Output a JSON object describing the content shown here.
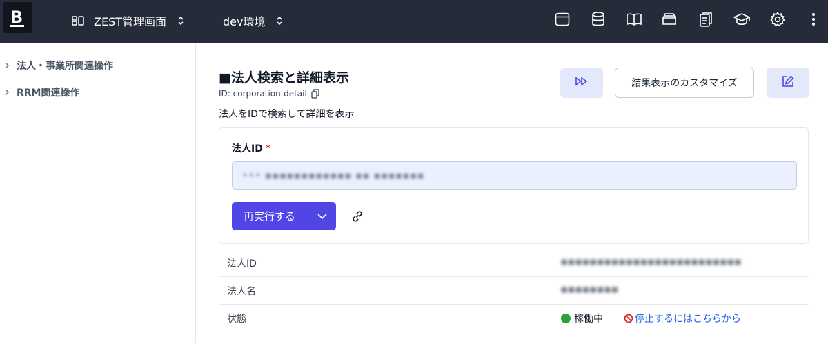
{
  "header": {
    "logo_letter": "B",
    "project_name": "ZEST管理画面",
    "environment": "dev環境",
    "icons": [
      "window-icon",
      "database-icon",
      "book-icon",
      "archive-icon",
      "clipboard-icon",
      "graduation-cap-icon",
      "gear-icon",
      "more-vertical-icon"
    ]
  },
  "sidebar": {
    "items": [
      {
        "label": "法人・事業所関連操作"
      },
      {
        "label": "RRM関連操作"
      }
    ]
  },
  "page": {
    "title": "■法人検索と詳細表示",
    "id_label": "ID: corporation-detail",
    "description": "法人をIDで検索して詳細を表示",
    "customize_label": "結果表示のカスタマイズ"
  },
  "form": {
    "field_label": "法人ID",
    "required_mark": "*",
    "field_value": "••• ▪▪▪▪▪▪▪▪▪▪▪▪ ▪▪ ▪▪▪▪▪▪▪",
    "run_label": "再実行する"
  },
  "results": {
    "rows": [
      {
        "key": "法人ID",
        "value": "▪▪▪▪▪▪▪▪▪▪▪▪▪▪▪▪▪▪▪▪▪▪▪▪▪"
      },
      {
        "key": "法人名",
        "value": "▪▪▪▪▪▪▪▪"
      },
      {
        "key": "状態",
        "value": "稼働中",
        "link": "停止するにはこちらから"
      }
    ]
  },
  "colors": {
    "topbar": "#252b38",
    "accent": "#5046e5",
    "accent_soft": "#e4e8fb",
    "status_ok": "#2aa33a",
    "link": "#2563eb"
  }
}
